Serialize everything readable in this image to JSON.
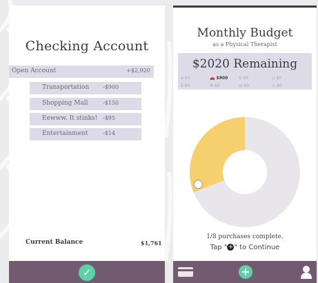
{
  "checking": {
    "title": "Checking Account",
    "open_account": {
      "label": "Open Account",
      "amount": "+$2,920"
    },
    "transactions": [
      {
        "label": "Transportation",
        "amount": "-$900"
      },
      {
        "label": "Shopping Mall",
        "amount": "-$150"
      },
      {
        "label": "Eewww.  It stinks!",
        "amount": "-$95"
      },
      {
        "label": "Entertainment",
        "amount": "-$14"
      }
    ],
    "balance_label": "Current Balance",
    "balance_amount": "$1,761"
  },
  "budget": {
    "title": "Monthly Budget",
    "subtitle": "as a Physical Therapist",
    "remaining": "$2020 Remaining",
    "categories": [
      {
        "icon": "housing-icon",
        "glyph": "⌂",
        "amount": "$0"
      },
      {
        "icon": "car-icon",
        "glyph": "🚗",
        "amount": "$900",
        "highlight": true
      },
      {
        "icon": "food-icon",
        "glyph": "♀",
        "amount": "$0"
      },
      {
        "icon": "tag-icon",
        "glyph": "◇",
        "amount": "$0"
      },
      {
        "icon": "education-icon",
        "glyph": "⌸",
        "amount": "$0"
      },
      {
        "icon": "shopping-cart-icon",
        "glyph": "⊞",
        "amount": "$0"
      },
      {
        "icon": "entertainment-icon",
        "glyph": "◎",
        "amount": "$0"
      },
      {
        "icon": "misc-icon",
        "glyph": "⚠",
        "amount": "$0"
      }
    ],
    "donut": {
      "spent_fraction": 0.31,
      "spent_color": "#f6cf6f",
      "rest_color": "#e8e6ea"
    },
    "progress": "1/8 purchases complete.",
    "tap_before": "Tap \"",
    "tap_after": "\" to Continue"
  },
  "colors": {
    "bar": "#725b70",
    "accent": "#5fd1a6",
    "row": "#dedbe8"
  }
}
